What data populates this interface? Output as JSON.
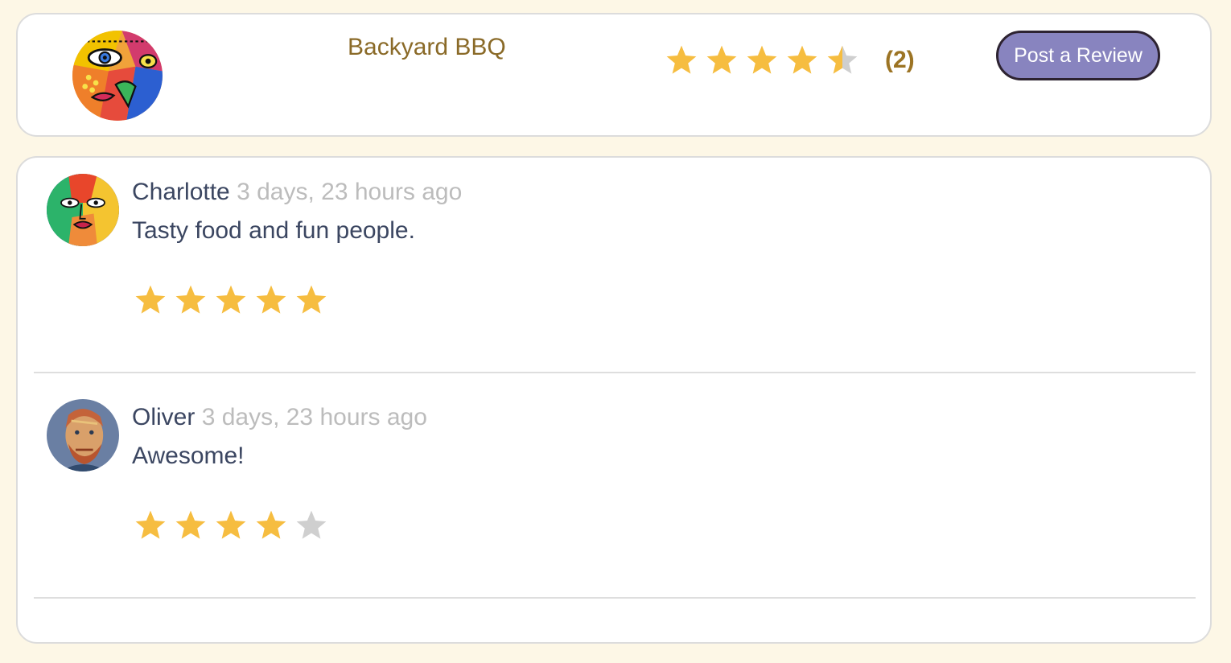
{
  "header": {
    "restaurant_name": "Backyard BBQ",
    "rating": 4.5,
    "review_count": "(2)",
    "post_button": "Post a Review"
  },
  "colors": {
    "star_filled": "#f6bd40",
    "star_empty": "#cfcfcf",
    "accent_button": "#8884bf",
    "title_gold": "#8a6a28"
  },
  "reviews": [
    {
      "name": "Charlotte",
      "time": "3 days, 23 hours ago",
      "text": "Tasty food and fun people.",
      "rating": 5
    },
    {
      "name": "Oliver",
      "time": "3 days, 23 hours ago",
      "text": "Awesome!",
      "rating": 4
    }
  ]
}
